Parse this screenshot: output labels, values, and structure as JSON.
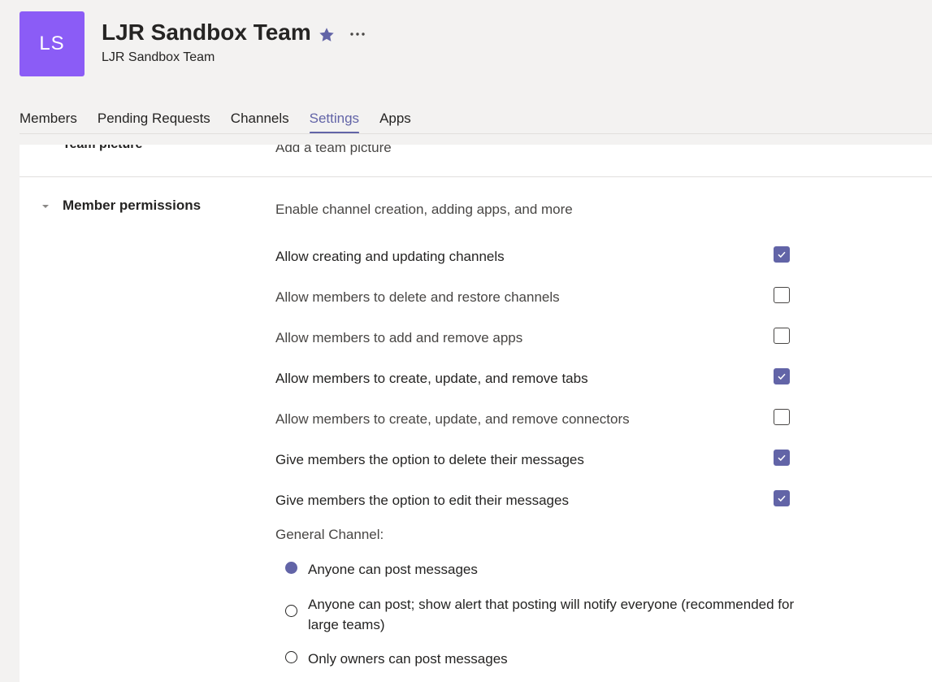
{
  "header": {
    "avatar_initials": "LS",
    "avatar_color": "#8b5cf6",
    "title": "LJR Sandbox Team",
    "subtitle": "LJR Sandbox Team",
    "star_icon": "star-icon",
    "more_icon": "more-options-icon"
  },
  "tabs": [
    {
      "label": "Members",
      "active": false
    },
    {
      "label": "Pending Requests",
      "active": false
    },
    {
      "label": "Channels",
      "active": false
    },
    {
      "label": "Settings",
      "active": true
    },
    {
      "label": "Apps",
      "active": false
    }
  ],
  "accent_color": "#6264a7",
  "sections": {
    "team_picture": {
      "title": "Team picture",
      "description": "Add a team picture"
    },
    "member_permissions": {
      "title": "Member permissions",
      "description": "Enable channel creation, adding apps, and more",
      "options": [
        {
          "label": "Allow creating and updating channels",
          "checked": true
        },
        {
          "label": "Allow members to delete and restore channels",
          "checked": false
        },
        {
          "label": "Allow members to add and remove apps",
          "checked": false
        },
        {
          "label": "Allow members to create, update, and remove tabs",
          "checked": true
        },
        {
          "label": "Allow members to create, update, and remove connectors",
          "checked": false
        },
        {
          "label": "Give members the option to delete their messages",
          "checked": true
        },
        {
          "label": "Give members the option to edit their messages",
          "checked": true
        }
      ],
      "general_channel_label": "General Channel:",
      "general_channel_options": [
        {
          "label": "Anyone can post messages",
          "selected": true
        },
        {
          "label": "Anyone can post; show alert that posting will notify everyone (recommended for large teams)",
          "selected": false
        },
        {
          "label": "Only owners can post messages",
          "selected": false
        }
      ]
    }
  }
}
